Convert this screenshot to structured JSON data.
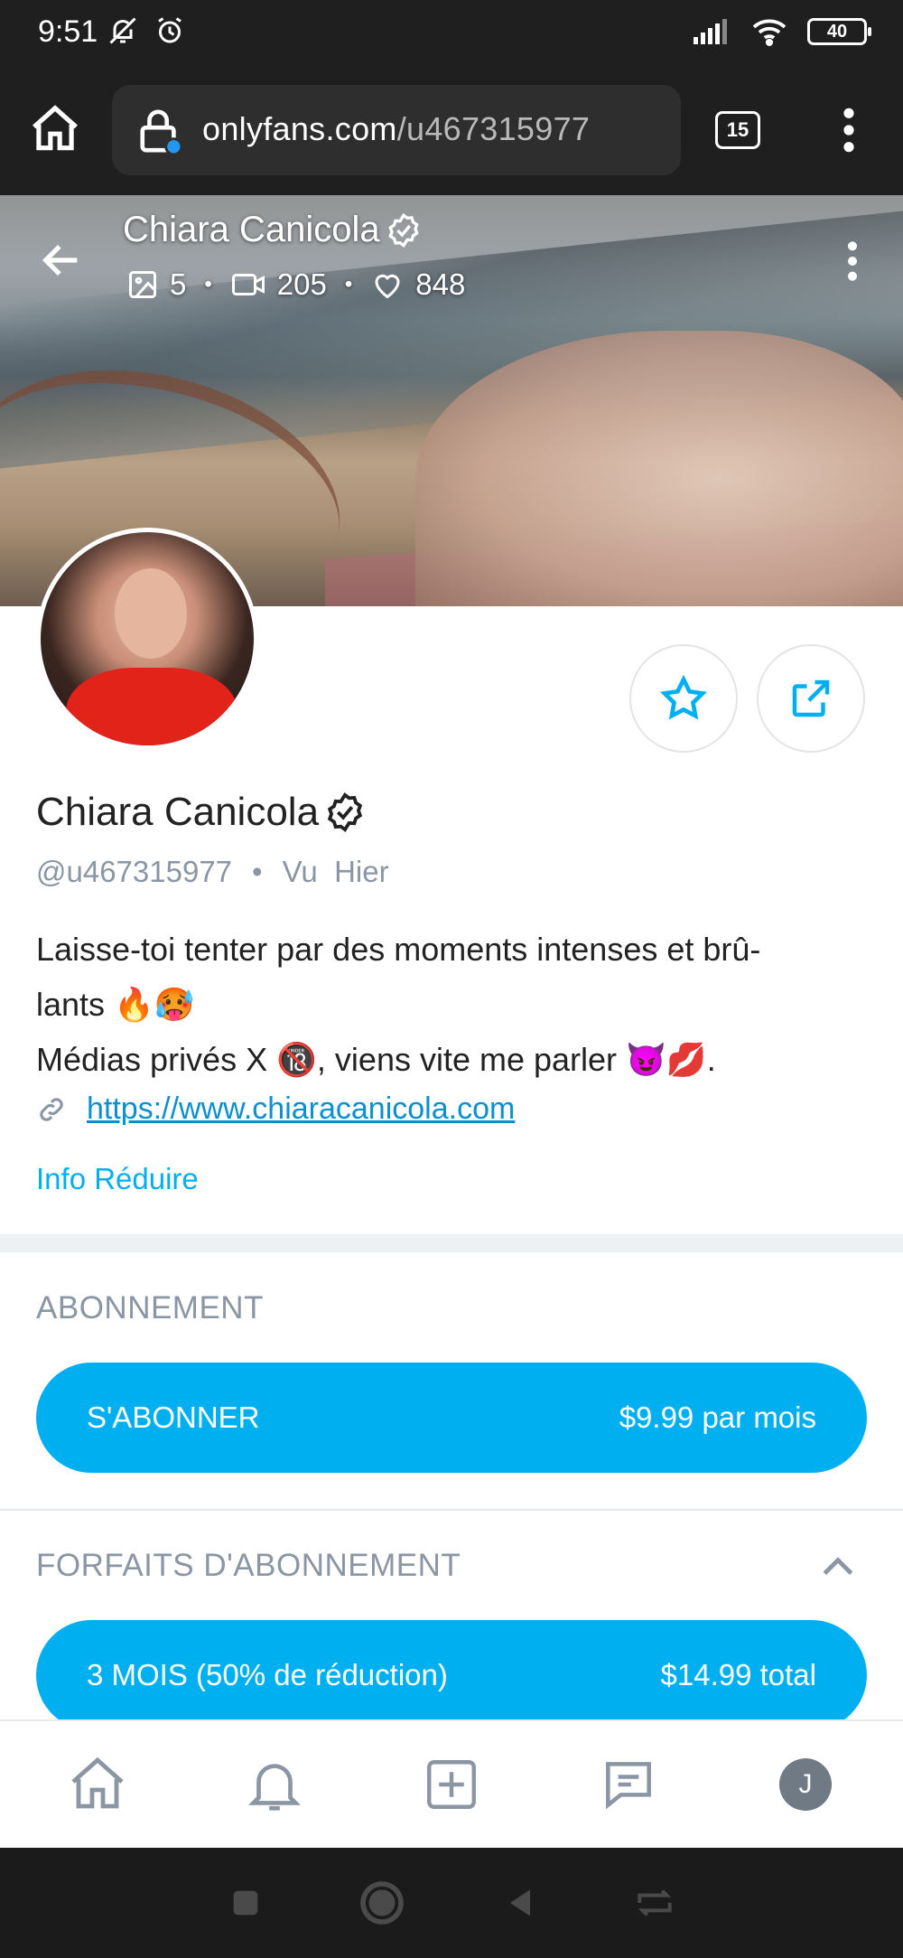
{
  "status_bar": {
    "time": "9:51",
    "battery": "40"
  },
  "browser": {
    "url_domain": "onlyfans.com",
    "url_path": "/u467315977",
    "tab_count": "15"
  },
  "cover": {
    "name": "Chiara Canicola",
    "photos": "5",
    "videos": "205",
    "likes": "848",
    "separator": "•"
  },
  "profile": {
    "name": "Chiara Canicola",
    "handle": "@u467315977",
    "separator": "•",
    "last_seen": "Vu  Hier",
    "bio_line1": "Laisse-toi tenter par des moments intenses et brû-",
    "bio_line2": "lants 🔥🥵",
    "bio_line3": "Médias privés X 🔞, viens vite me parler 😈💋.",
    "website": "https://www.chiaracanicola.com",
    "info_toggle": "Info Réduire"
  },
  "subscription": {
    "title": "ABONNEMENT",
    "subscribe_label": "S'ABONNER",
    "subscribe_price": "$9.99 par mois"
  },
  "bundles": {
    "title": "FORFAITS D'ABONNEMENT",
    "bundle_label": "3 MOIS (50% de réduction)",
    "bundle_price": "$14.99 total"
  },
  "bottom_nav": {
    "avatar_initial": "J"
  },
  "colors": {
    "accent": "#00aff0",
    "link": "#0b8fd0",
    "muted": "#8a96a3",
    "chrome": "#1f1f1f"
  }
}
